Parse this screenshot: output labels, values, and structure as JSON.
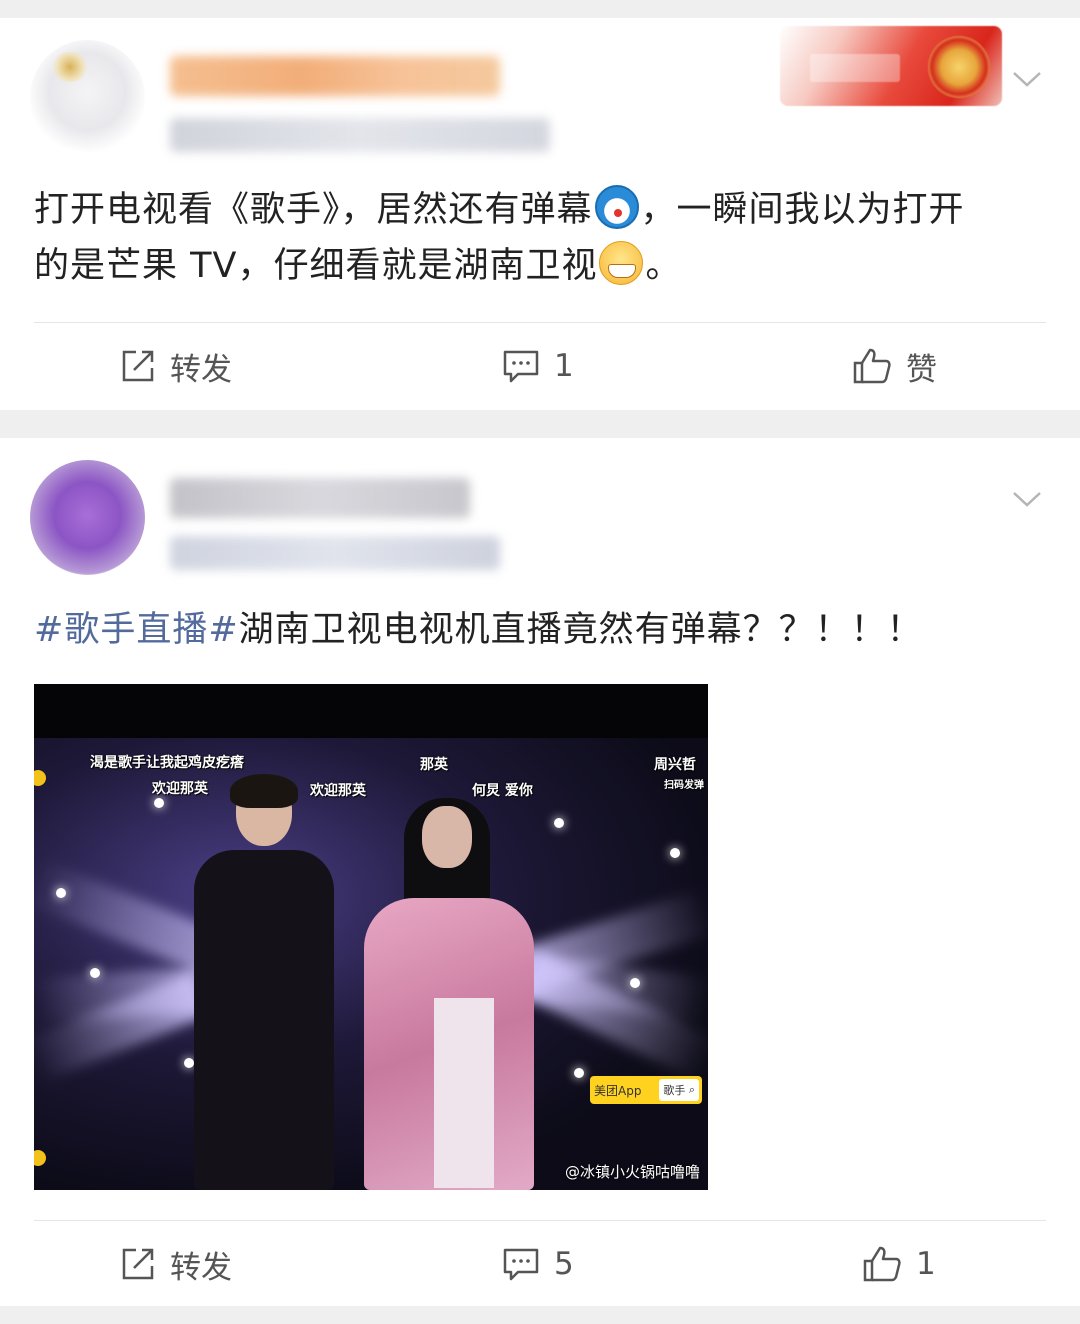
{
  "posts": [
    {
      "text_before_emoji": "打开电视看《歌手》，居然还有弹幕",
      "emoji_1": "doraemon-emoji",
      "text_after_emoji": "，一瞬间我以为打开",
      "text_line2": "的是芒果 TV，仔细看就是湖南卫视",
      "emoji_2": "grin-emoji",
      "text_end": "。",
      "actions": {
        "share_label": "转发",
        "comment_count": "1",
        "like_label": "赞"
      }
    },
    {
      "hashtag": "#歌手直播#",
      "text": "湖南卫视电视机直播竟然有弹幕？？！！！",
      "image": {
        "danmaku": [
          "渴是歌手让我起鸡皮疙瘩",
          "欢迎那英",
          "欢迎那英",
          "那英",
          "何炅 爱你",
          "周兴哲",
          "扫码发弹"
        ],
        "ad_app": "美团App",
        "ad_search": "歌手",
        "watermark": "@冰镇小火锅咕噜噜"
      },
      "actions": {
        "share_label": "转发",
        "comment_count": "5",
        "like_count": "1"
      }
    }
  ],
  "colors": {
    "hashtag": "#536b9c",
    "text": "#222222",
    "action": "#555555",
    "page_bg": "#efefef"
  }
}
